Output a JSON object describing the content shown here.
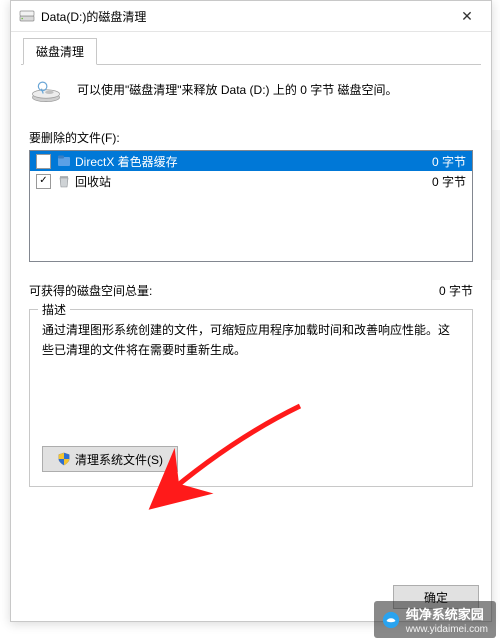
{
  "window": {
    "title": "Data(D:)的磁盘清理",
    "close_glyph": "✕"
  },
  "tab": {
    "label": "磁盘清理"
  },
  "intro": {
    "text": "可以使用\"磁盘清理\"来释放 Data (D:) 上的 0 字节 磁盘空间。"
  },
  "files": {
    "label": "要删除的文件(F):",
    "items": [
      {
        "checked": false,
        "selected": true,
        "name": "DirectX 着色器缓存",
        "size": "0 字节"
      },
      {
        "checked": true,
        "selected": false,
        "name": "回收站",
        "size": "0 字节"
      }
    ]
  },
  "total": {
    "label": "可获得的磁盘空间总量:",
    "value": "0 字节"
  },
  "description": {
    "legend": "描述",
    "text": "通过清理图形系统创建的文件，可缩短应用程序加载时间和改善响应性能。这些已清理的文件将在需要时重新生成。"
  },
  "buttons": {
    "clean_system": "清理系统文件(S)",
    "ok": "确定"
  },
  "watermark": {
    "name": "纯净系统家园",
    "url": "www.yidaimei.com"
  }
}
